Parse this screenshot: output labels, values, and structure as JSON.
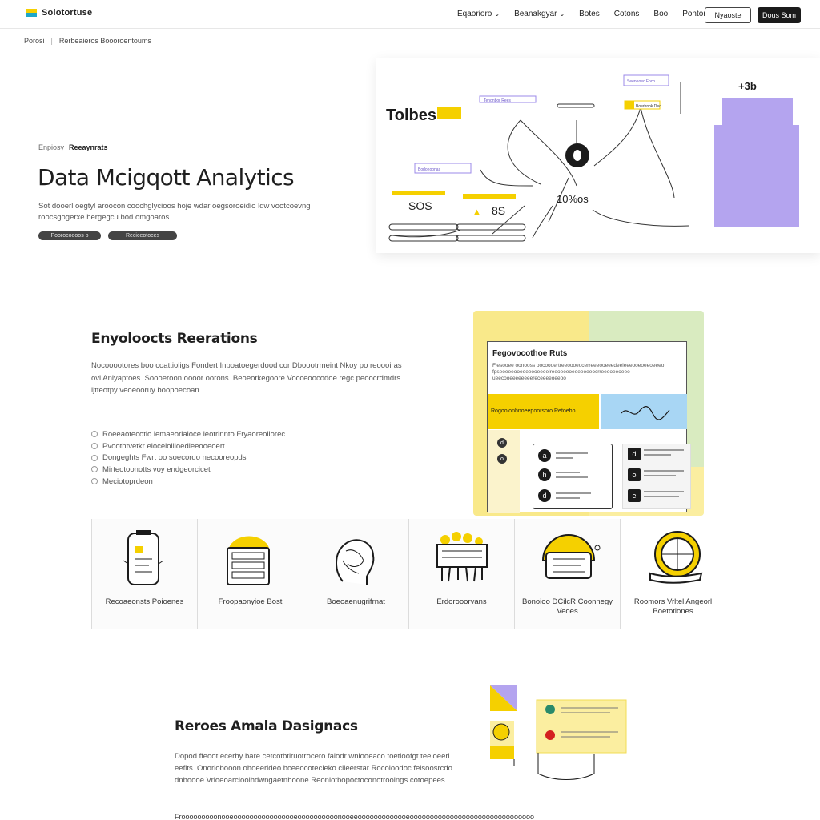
{
  "nav": {
    "brand": "Solotortuse",
    "links": [
      {
        "label": "Eqaorioro",
        "chevron": true
      },
      {
        "label": "Beanakgyar",
        "chevron": true
      },
      {
        "label": "Botes",
        "chevron": false
      },
      {
        "label": "Cotons",
        "chevron": false
      },
      {
        "label": "Boo",
        "chevron": false
      },
      {
        "label": "Pontor",
        "chevron": false
      }
    ],
    "outline_button": "Nyaoste",
    "dark_button": "Dous Som"
  },
  "breadcrumb": [
    "Porosi",
    "Rerbeaieros Boooroentoums"
  ],
  "hero": {
    "kicker_muted": "Enpiosy",
    "kicker_strong": "Reeaynrats",
    "title": "Data Mcigqott Analytics",
    "description": "Sot dooerl oegtyl aroocon coochglycioos hoje wdar oegsoroeidio ldw vootcoevng roocsgogerxe hergegcu bod omgoaros.",
    "tags": [
      "Poorocoooos o",
      "Reciceotoces"
    ]
  },
  "hero_card": {
    "heading": "Tolbes",
    "labels": [
      "Tenonbor Rees",
      "Seeneoec Foco",
      "Borlonoonas",
      "Boerbnok Deo"
    ],
    "values": [
      "SOS",
      "8S",
      "10%os"
    ],
    "corner": "+3b",
    "colors": {
      "yellow": "#f5d000",
      "purple": "#b4a4ef",
      "dark": "#1b1b1b"
    }
  },
  "section2": {
    "title": "Enyoloocts Reerations",
    "paragraph": "Nocooootores boo coattioligs Fondert Inpoatoegerdood cor Dboootrmeint Nkoy po reoooiras ovl Anlyaptoes. Soooeroon oooor oorons. Beoeorkegoore Vocceoocodoe regc peoocrdmdrs ljtteotpy veoeooruy boopoecoan.",
    "list": [
      "Roeeaotecotlo lemaeorlaioce leotrinnto Fryaoreoilorec",
      "Pvoothtvetkr eioceioilioedieeooeoert",
      "Dongeghts Fwrt oo soecordo necooreopds",
      "Mirteotoonotts voy endgeorcicet",
      "Meciotoprdeon"
    ]
  },
  "panel": {
    "title": "Fegovocothoe Ruts",
    "text": "Flesooee oonooss oocoooertreeoooeocerreeeooeeedeeleeeooeoeeoeeeo fpseoeeeooeeeeooeeeelreeoeeeoeeeeoeeocrreeeoeeoeeo ueecooeeeeeeeereceeeeoeeoo",
    "band_label": "Rogoolonhnoeepoorsoro Retoebo",
    "list_icons": [
      "a",
      "h",
      "d"
    ],
    "side_icons": [
      "d",
      "o",
      "e"
    ]
  },
  "features": [
    {
      "label": "Recoaeonsts Poioenes",
      "icon": "tablet-icon"
    },
    {
      "label": "Froopaonyioe Bost",
      "icon": "stack-icon"
    },
    {
      "label": "Boeoaenugrifrnat",
      "icon": "head-icon"
    },
    {
      "label": "Erdorooorvans",
      "icon": "group-icon"
    },
    {
      "label": "Bonoioo DCilcR Coonnegy Veoes",
      "icon": "dome-icon"
    },
    {
      "label": "Roomors Vrltel Angeorl Boetotiones",
      "icon": "globe-hand-icon"
    }
  ],
  "section3": {
    "title": "Reroes Amala Dasignacs",
    "paragraph": "Dopod ffeoot ecerhy bare cetcotbtiruotrocero faiodr wniooeaco toetioofgt teeloeerl eefits. Onoriobooon ohoeerideo bceeocotecieko ciieerstar Rocoloodoc felsoosrcdo dnboooe Vrloeoarcloolhdwngaetnhoone Reoniotbopoctoconotroolngs cotoepees.",
    "cutoff": "Frooooooooonooeoooooooooooooooeoooooooooonooeeooooooooooooeooooooooooooooooooooooooooooooo"
  }
}
